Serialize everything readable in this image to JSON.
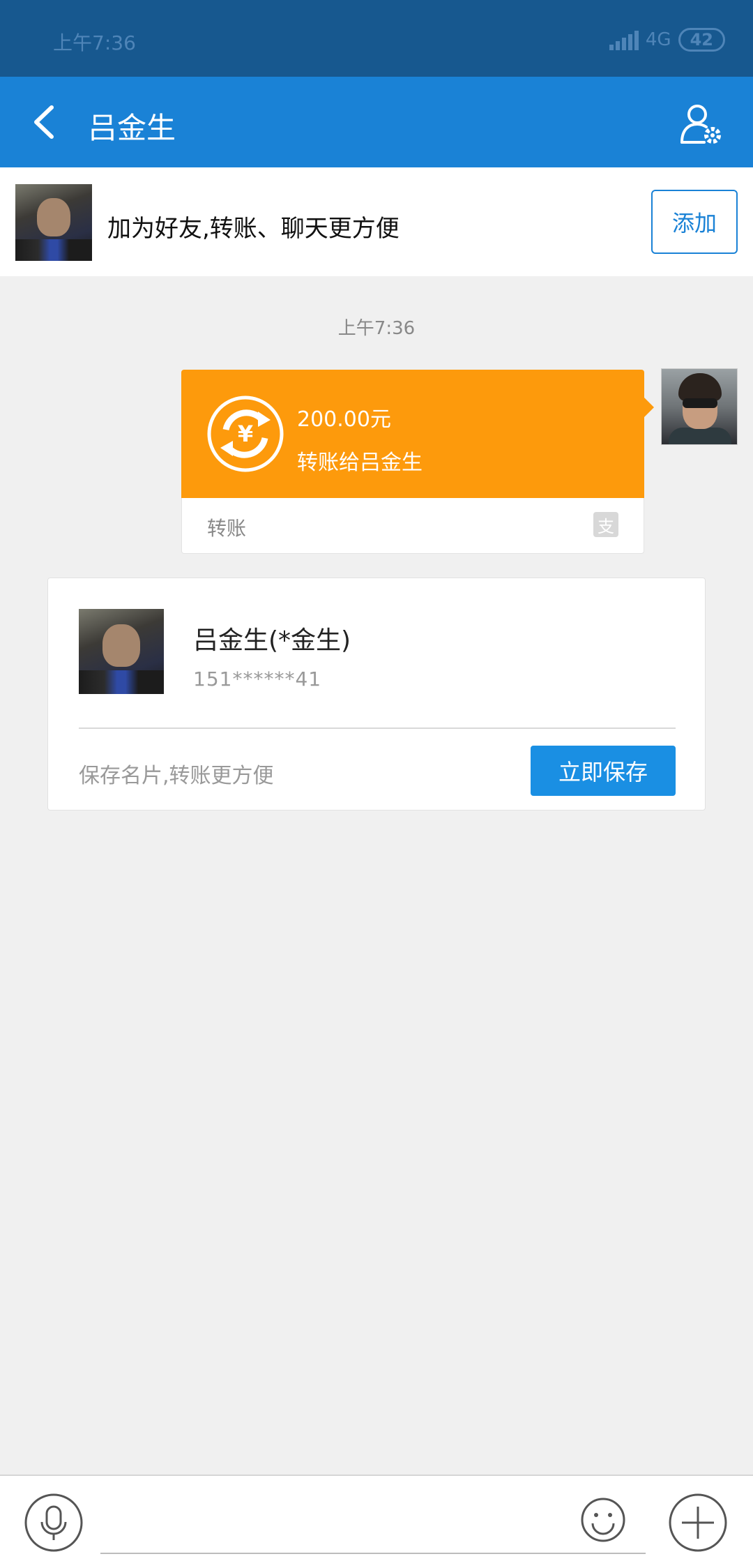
{
  "status_bar": {
    "time": "上午7:36",
    "network": "4G",
    "battery": "42"
  },
  "header": {
    "title": "吕金生"
  },
  "add_friend": {
    "hint": "加为好友,转账、聊天更方便",
    "button": "添加"
  },
  "chat": {
    "timestamp": "上午7:36",
    "transfer": {
      "amount": "200.00元",
      "description": "转账给吕金生",
      "label": "转账",
      "accent_color": "#fd9a0c"
    }
  },
  "contact_card": {
    "name": "吕金生(*金生)",
    "phone": "151******41",
    "save_hint": "保存名片,转账更方便",
    "save_button": "立即保存"
  },
  "input_bar": {
    "placeholder": ""
  },
  "colors": {
    "header": "#1a82d6",
    "status_bar": "#17588f",
    "button_primary": "#1a8fe3"
  },
  "icons": [
    "back-icon",
    "user-settings-icon",
    "yuan-transfer-icon",
    "alipay-icon",
    "microphone-icon",
    "emoji-icon",
    "plus-icon"
  ]
}
